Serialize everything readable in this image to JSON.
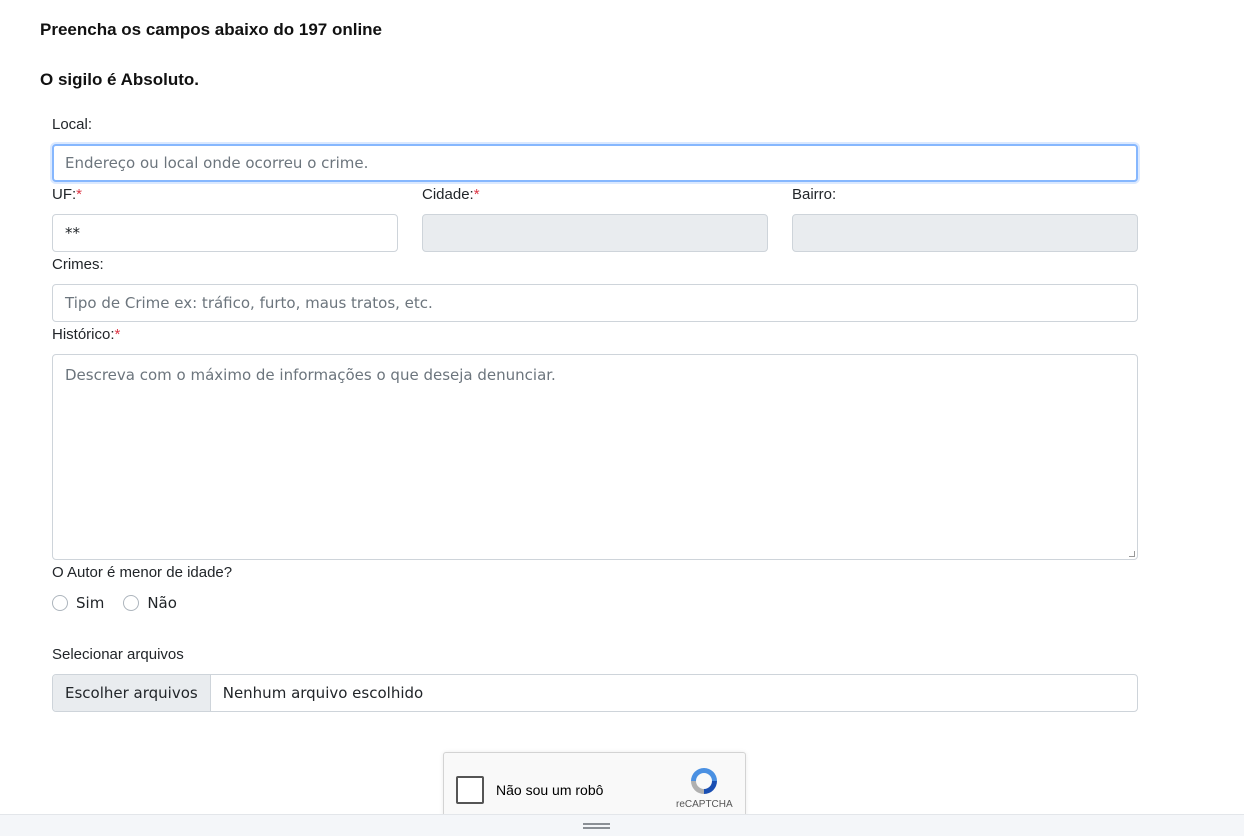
{
  "header": {
    "title": "Preencha os campos abaixo do 197 online",
    "subtitle": "O sigilo é Absoluto."
  },
  "form": {
    "local_label": "Local:",
    "local_placeholder": "Endereço ou local onde ocorreu o crime.",
    "uf_label": "UF:",
    "uf_value": "**",
    "cidade_label": "Cidade:",
    "bairro_label": "Bairro:",
    "required_mark": "*",
    "crimes_label": "Crimes:",
    "crimes_placeholder": "Tipo de Crime ex: tráfico, furto, maus tratos, etc.",
    "historico_label": "Histórico:",
    "historico_placeholder": "Descreva com o máximo de informações o que deseja denunciar.",
    "menor_question": "O Autor é menor de idade?",
    "menor_options": [
      "Sim",
      "Não"
    ],
    "files_label": "Selecionar arquivos",
    "files_button": "Escolher arquivos",
    "files_status": "Nenhum arquivo escolhido"
  },
  "captcha": {
    "label": "Não sou um robô",
    "brand": "reCAPTCHA"
  },
  "colors": {
    "required": "#dc3545",
    "focus_border": "#86b7fe",
    "disabled_bg": "#e9ecef"
  }
}
